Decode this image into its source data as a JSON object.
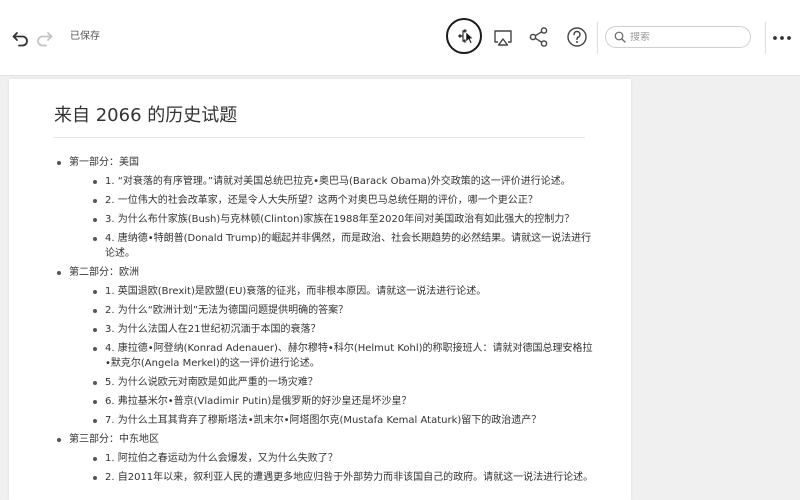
{
  "toolbar": {
    "saved_status": "已保存",
    "undo_icon": "undo-icon",
    "redo_icon": "redo-icon",
    "mindmap_icon": "mindmap-icon",
    "present_icon": "present-icon",
    "share_icon": "share-icon",
    "help_icon": "help-icon",
    "search_placeholder": "搜索",
    "more_icon": "more-icon"
  },
  "document": {
    "title": "来自 2066 的历史试题",
    "sections": [
      {
        "label": "第一部分：美国",
        "items": [
          "1. “对衰落的有序管理。”请就对美国总统巴拉克•奥巴马(Barack Obama)外交政策的这一评价进行论述。",
          "2. 一位伟大的社会改革家，还是令人大失所望？这两个对奥巴马总统任期的评价，哪一个更公正？",
          "3. 为什么布什家族(Bush)与克林顿(Clinton)家族在1988年至2020年间对美国政治有如此强大的控制力？",
          "4. 唐纳德•特朗普(Donald Trump)的崛起并非偶然，而是政治、社会长期趋势的必然结果。请就这一说法进行论述。"
        ]
      },
      {
        "label": "第二部分：欧洲",
        "items": [
          "1. 英国退欧(Brexit)是欧盟(EU)衰落的征兆，而非根本原因。请就这一说法进行论述。",
          "2. 为什么“欧洲计划”无法为德国问题提供明确的答案？",
          "3. 为什么法国人在21世纪初沉湎于本国的衰落？",
          "4. 康拉德•阿登纳(Konrad Adenauer)、赫尔穆特•科尔(Helmut Kohl)的称职接班人：请就对德国总理安格拉•默克尔(Angela Merkel)的这一评价进行论述。",
          "5. 为什么说欧元对南欧是如此严重的一场灾难？",
          "6. 弗拉基米尔•普京(Vladimir Putin)是俄罗斯的好沙皇还是坏沙皇？",
          "7. 为什么土耳其背弃了穆斯塔法•凯末尔•阿塔图尔克(Mustafa Kemal Ataturk)留下的政治遗产？"
        ]
      },
      {
        "label": "第三部分：中东地区",
        "items": [
          "1. 阿拉伯之春运动为什么会爆发，又为什么失败了？",
          "2. 自2011年以来，叙利亚人民的遭遇更多地应归咎于外部势力而非该国自己的政府。请就这一说法进行论述。"
        ]
      }
    ]
  }
}
